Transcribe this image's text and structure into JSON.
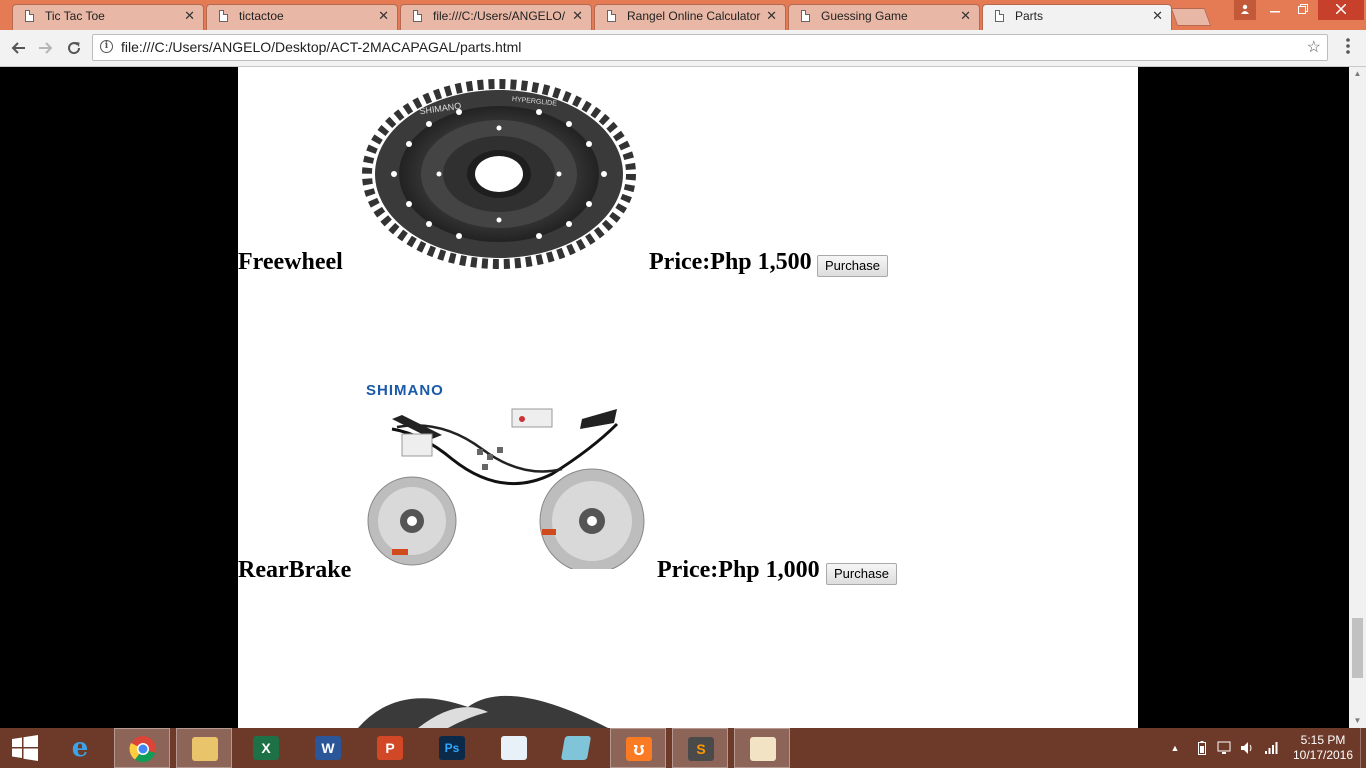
{
  "browser": {
    "tabs": [
      {
        "title": "Tic Tac Toe",
        "active": false
      },
      {
        "title": "tictactoe",
        "active": false
      },
      {
        "title": "file:///C:/Users/ANGELO/",
        "active": false
      },
      {
        "title": "Rangel Online Calculator",
        "active": false
      },
      {
        "title": "Guessing Game",
        "active": false
      },
      {
        "title": "Parts",
        "active": true
      }
    ],
    "tab_close_glyph": "✕",
    "url": "file:///C:/Users/ANGELO/Desktop/ACT-2MACAPAGAL/parts.html"
  },
  "parts": [
    {
      "name": "Freewheel",
      "price": "Price:Php 1,500",
      "button": "Purchase",
      "image_icon": "cassette-sprocket-image"
    },
    {
      "name": "RearBrake",
      "price": "Price:Php 1,000",
      "button": "Purchase",
      "image_icon": "disc-brake-set-image",
      "image_brand": "SHIMANO"
    }
  ],
  "freewheel_image_text": [
    "SHIMANO",
    "HYPERGLIDE"
  ],
  "taskbar": {
    "apps": [
      "internet-explorer-icon",
      "chrome-icon",
      "file-explorer-icon",
      "excel-icon",
      "word-icon",
      "powerpoint-icon",
      "photoshop-icon",
      "mysql-installer-icon",
      "notepad-icon",
      "xampp-icon",
      "sublime-text-icon",
      "paint-icon"
    ],
    "clock_time": "5:15 PM",
    "clock_date": "10/17/2016"
  },
  "colors": {
    "tabstrip": "#e57b55",
    "taskbar": "#6d3a2a",
    "page_background": "#ffffff",
    "side_background": "#000000",
    "shimano_blue": "#1a5aa8"
  }
}
